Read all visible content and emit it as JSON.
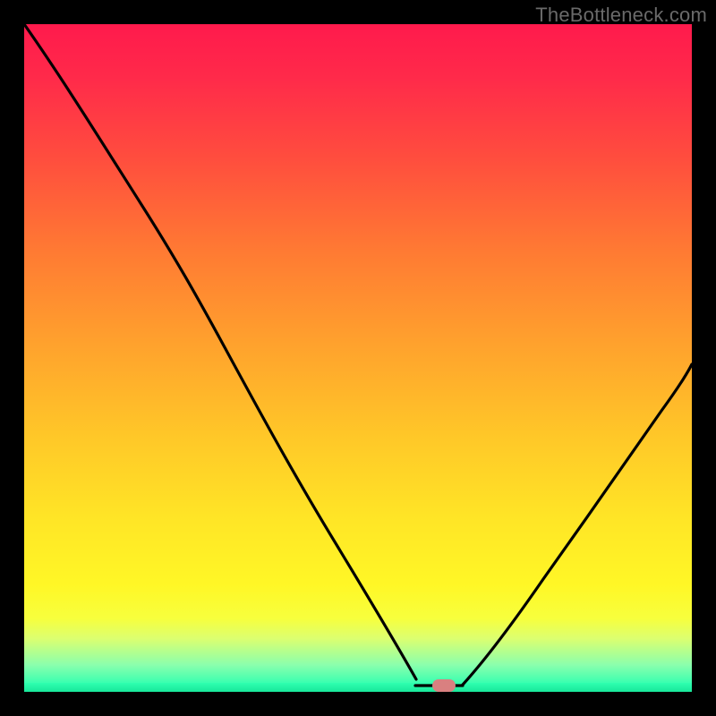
{
  "watermark": "TheBottleneck.com",
  "marker": {
    "x_pct": 62.7,
    "y_pct": 99.0,
    "color": "#d97f7f"
  },
  "chart_data": {
    "type": "line",
    "title": "",
    "xlabel": "",
    "ylabel": "",
    "xlim": [
      0,
      100
    ],
    "ylim": [
      0,
      100
    ],
    "grid": false,
    "legend": false,
    "note": "Percent-of-plot coordinates; x increases rightward, y is bottleneck% with 0 at bottom and 100 at top. Curve is a V shape with minimum near x≈62.",
    "series": [
      {
        "name": "bottleneck-curve",
        "x": [
          0,
          6,
          12,
          18,
          24,
          28,
          32,
          36,
          40,
          44,
          48,
          52,
          56,
          58,
          60,
          62,
          64,
          66,
          70,
          76,
          84,
          92,
          100
        ],
        "y": [
          100,
          91,
          82,
          73,
          66,
          61,
          55,
          47,
          39,
          31,
          23,
          15,
          7,
          4.2,
          2,
          1,
          1,
          2,
          7,
          15,
          29,
          42,
          55
        ]
      }
    ],
    "flat_bottom": {
      "x_start_pct": 58.5,
      "x_end_pct": 65.5,
      "y_pct": 99.2
    },
    "marker_point": {
      "x_pct": 62.7,
      "y_pct": 99.0
    },
    "background_gradient": {
      "orientation": "vertical",
      "stops": [
        {
          "pct": 0,
          "color": "#ff1a4c",
          "meaning": "high-bottleneck"
        },
        {
          "pct": 50,
          "color": "#ffa22d"
        },
        {
          "pct": 84,
          "color": "#fff726"
        },
        {
          "pct": 99,
          "color": "#2fffb0",
          "meaning": "no-bottleneck"
        }
      ]
    }
  }
}
